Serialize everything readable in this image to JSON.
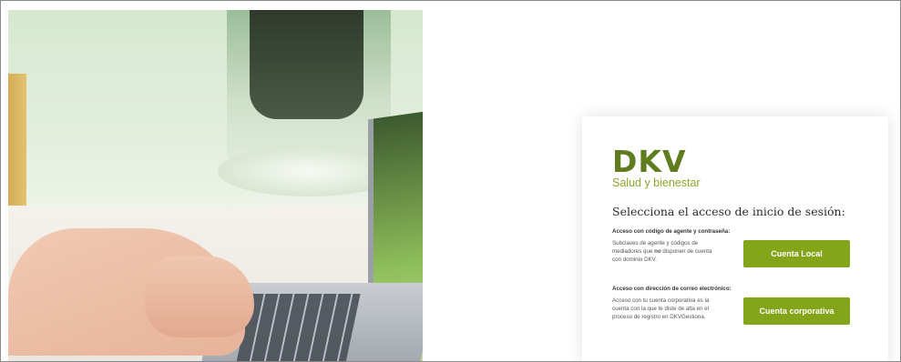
{
  "brand": {
    "logo_text": "DKV",
    "tagline": "Salud y bienestar",
    "accent_color": "#84a51a",
    "logo_color": "#5f7d1f"
  },
  "login": {
    "title": "Selecciona el acceso de inicio de sesión:",
    "local": {
      "heading": "Acceso con código de agente y contraseña:",
      "description_before": "Subclaves de agente y códigos de mediadores que ",
      "description_bold": "no",
      "description_after": " disponen de cuenta con dominio DKV.",
      "button_label": "Cuenta Local"
    },
    "corporate": {
      "heading": "Acceso con dirección de correo electrónico:",
      "description": "Acceso con tu cuenta corporativa es la cuenta con la que te diste de alta en el proceso de registro en DKVGestiona.",
      "button_label": "Cuenta corporativa"
    }
  }
}
